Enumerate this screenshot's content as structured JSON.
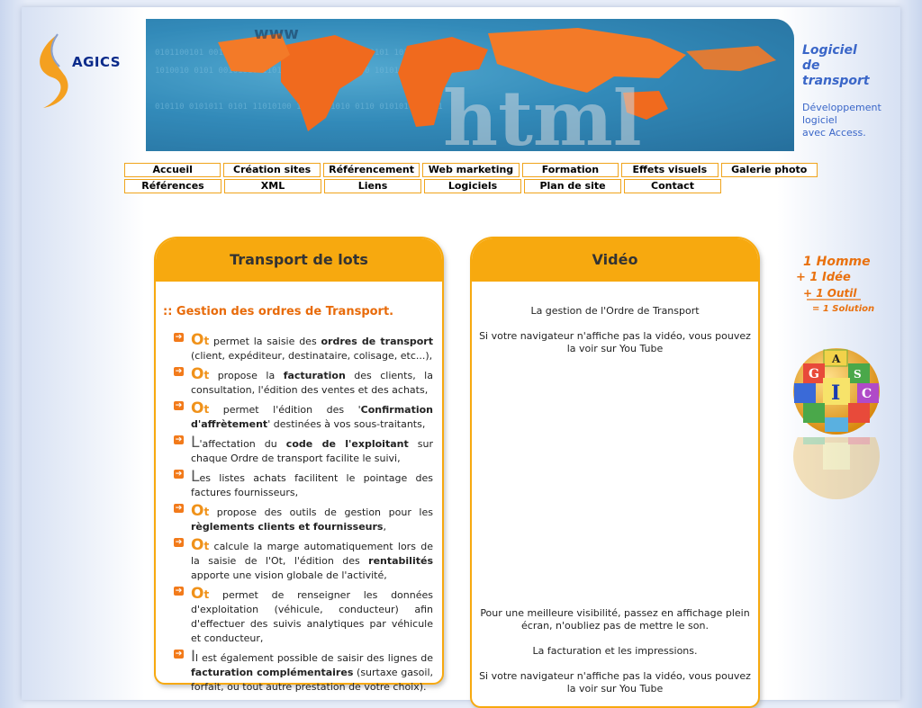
{
  "logo": {
    "text": "AGICS"
  },
  "banner": {
    "word": "html",
    "www": "www"
  },
  "side": {
    "title_line1": "Logiciel",
    "title_line2": "de",
    "title_line3": "transport",
    "desc_line1": "Développement",
    "desc_line2": "logiciel",
    "desc_line3": "avec Access."
  },
  "nav": {
    "row1": [
      "Accueil",
      "Création sites",
      "Référencement",
      "Web marketing",
      "Formation",
      "Effets visuels",
      "Galerie photo"
    ],
    "row2": [
      "Références",
      "XML",
      "Liens",
      "Logiciels",
      "Plan de site",
      "Contact"
    ]
  },
  "left_panel": {
    "title": "Transport de lots",
    "section_title": ":: Gestion des ordres de Transport.",
    "items": [
      {
        "cap": "O",
        "capsub": "t",
        "a": " permet la saisie des ",
        "b": "ordres de transport",
        "c": " (client, expéditeur, destinataire, colisage, etc...),"
      },
      {
        "cap": "O",
        "capsub": "t",
        "a": " propose la ",
        "b": "facturation",
        "c": " des clients, la consultation, l'édition des ventes et des achats,"
      },
      {
        "cap": "O",
        "capsub": "t",
        "a": " permet l'édition des '",
        "b": "Confirmation d'affrètement",
        "c": "' destinées à vos sous-traitants,"
      },
      {
        "cap": "L",
        "capsub": "",
        "a": "'affectation du ",
        "b": "code de l'exploitant",
        "c": " sur chaque Ordre de transport facilite le suivi,"
      },
      {
        "cap": "L",
        "capsub": "",
        "a": "es listes achats facilitent le pointage des factures fournisseurs,",
        "b": "",
        "c": ""
      },
      {
        "cap": "O",
        "capsub": "t",
        "a": " propose des outils de gestion pour les ",
        "b": "règlements clients et fournisseurs",
        "c": ","
      },
      {
        "cap": "O",
        "capsub": "t",
        "a": " calcule la marge automatiquement lors de la saisie de l'Ot, l'édition des ",
        "b": "rentabilités",
        "c": " apporte une vision globale de l'activité,"
      },
      {
        "cap": "O",
        "capsub": "t",
        "a": " permet de renseigner les données d'exploitation (véhicule, conducteur) afin d'effectuer des suivis analytiques par véhicule et conducteur,",
        "b": "",
        "c": ""
      },
      {
        "cap": "I",
        "capsub": "",
        "a": "l est également possible de saisir des lignes de ",
        "b": "facturation complémentaires",
        "c": " (surtaxe gasoil, forfait, ou tout autre prestation de votre choix)."
      }
    ]
  },
  "right_panel": {
    "title": "Vidéo",
    "p1": "La gestion de l'Ordre de Transport",
    "p2": "Si votre navigateur n'affiche pas la vidéo, vous pouvez la voir sur You Tube",
    "p3": "Pour une meilleure visibilité, passez en affichage plein écran, n'oubliez pas de mettre le son.",
    "p4": "La facturation et les impressions.",
    "p5": "Si votre navigateur n'affiche pas la vidéo, vous pouvez la voir sur You Tube"
  },
  "slogan": {
    "l1": "1 Homme",
    "l2": "+ 1 Idée",
    "l3": "+ 1 Outil",
    "l4": "= 1 Solution"
  },
  "ball": {
    "letters": [
      "A",
      "G",
      "I",
      "C",
      "S"
    ]
  },
  "colors": {
    "accent": "#f7a90f",
    "orange_text": "#e86b0a",
    "blue_text": "#3a66c8"
  }
}
